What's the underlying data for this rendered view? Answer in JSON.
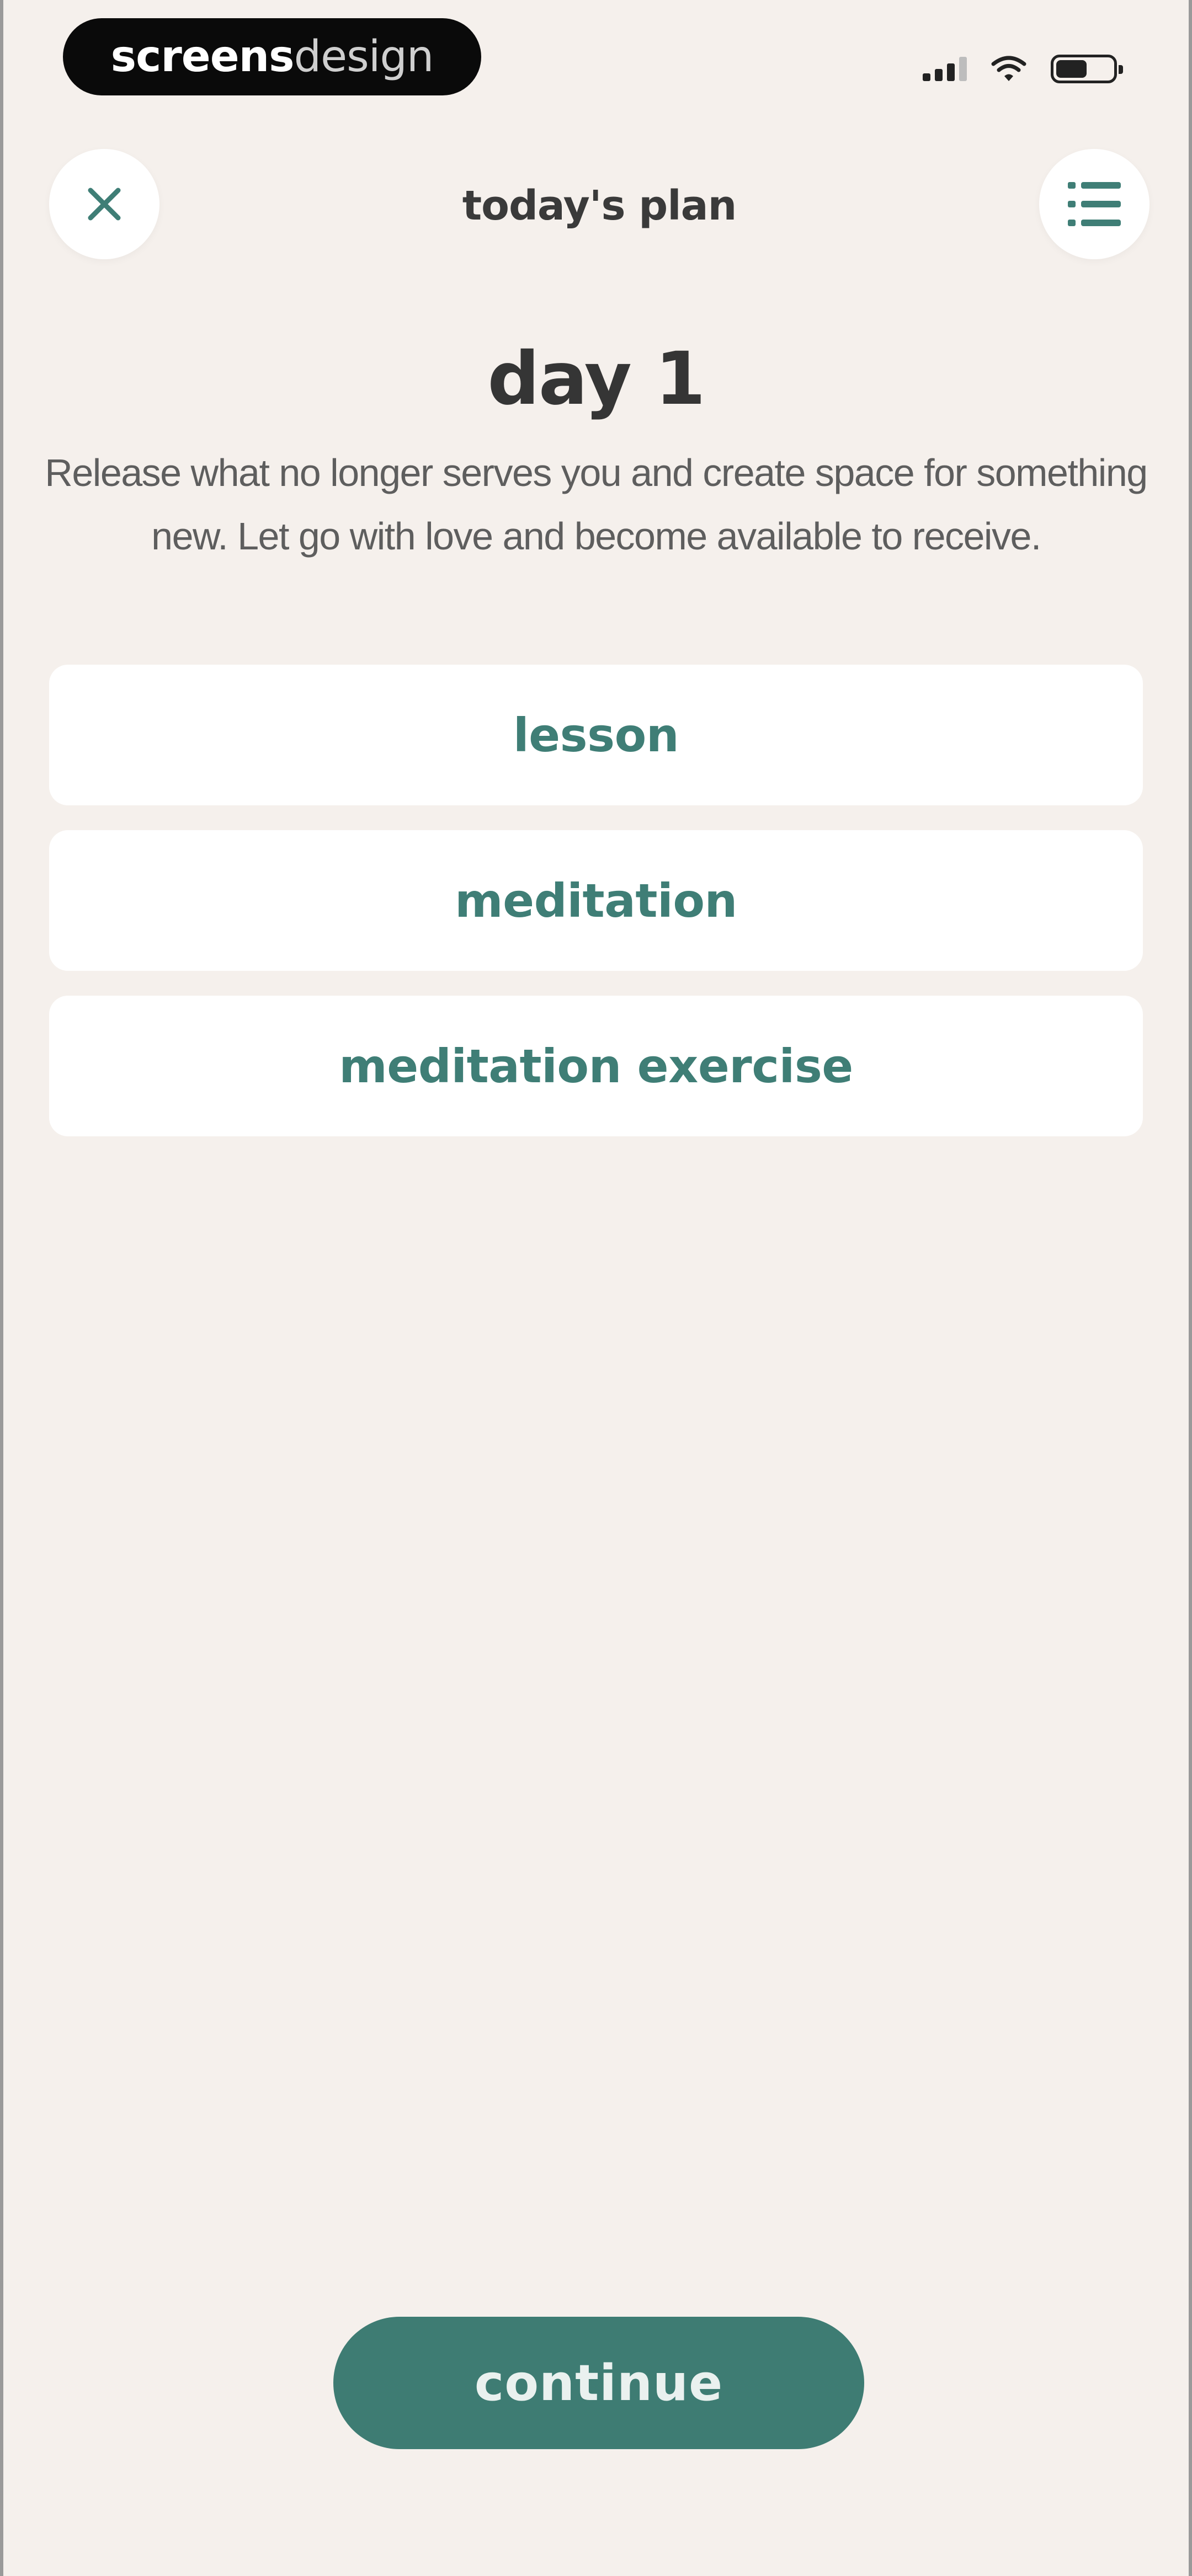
{
  "status_bar": {
    "brand_bold": "screens",
    "brand_light": "design",
    "icons": [
      "signal-icon",
      "wifi-icon",
      "battery-icon"
    ]
  },
  "header": {
    "title": "today's plan",
    "close_icon": "close-icon",
    "menu_icon": "list-icon"
  },
  "content": {
    "day_title": "day 1",
    "description": "Release what no longer serves you and create space for something new. Let go with love and become available to receive."
  },
  "plan_items": [
    {
      "label": "lesson"
    },
    {
      "label": "meditation"
    },
    {
      "label": "meditation exercise"
    }
  ],
  "footer": {
    "continue_label": "continue"
  },
  "colors": {
    "background": "#F5F0EC",
    "accent": "#3E7C73",
    "card": "#FFFFFF",
    "text_dark": "#353535"
  }
}
